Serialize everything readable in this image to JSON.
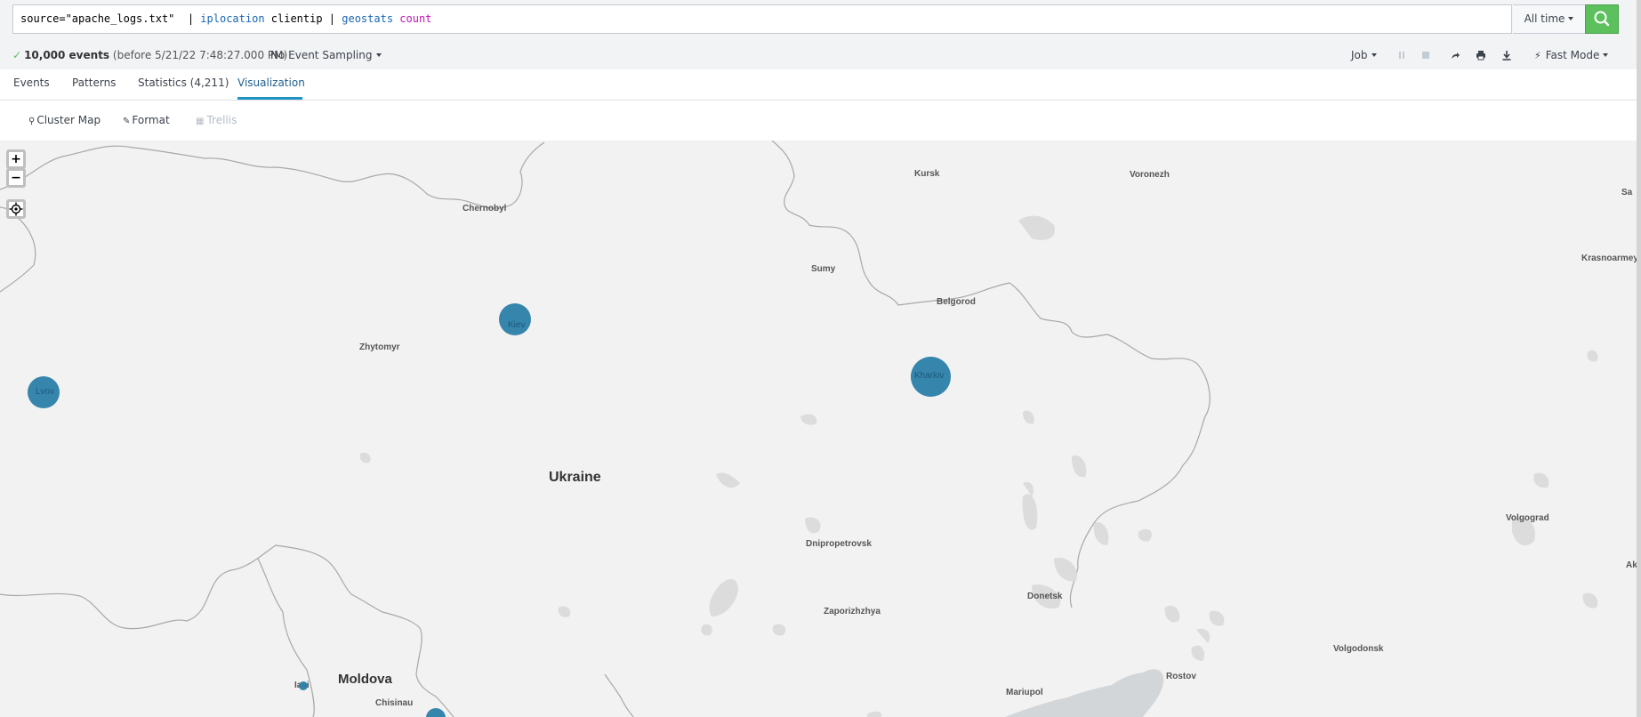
{
  "search": {
    "query_part1": "source=\"apache_logs.txt\"  | ",
    "query_cmd1": "iplocation",
    "query_part2": " clientip | ",
    "query_cmd2": "geostats",
    "query_part3": " ",
    "query_fn": "count",
    "time_range": "All time",
    "search_icon": "magnifier-icon"
  },
  "status": {
    "event_count": "10,000 events",
    "event_suffix": "(before 5/21/22 7:48:27.000 PM)",
    "sampling": "No Event Sampling",
    "job_label": "Job",
    "mode": "Fast Mode"
  },
  "tabs": [
    {
      "label": "Events"
    },
    {
      "label": "Patterns"
    },
    {
      "label": "Statistics (4,211)"
    },
    {
      "label": "Visualization",
      "active": true
    }
  ],
  "viz_toolbar": {
    "cluster_map": "Cluster Map",
    "format": "Format",
    "trellis": "Trellis"
  },
  "map": {
    "cities": [
      {
        "name": "Kursk"
      },
      {
        "name": "Voronezh"
      },
      {
        "name": "Chernobyl"
      },
      {
        "name": "Sumy"
      },
      {
        "name": "Belgorod"
      },
      {
        "name": "Krasnoarmey"
      },
      {
        "name": "Zhytomyr"
      },
      {
        "name": "Dnipropetrovsk"
      },
      {
        "name": "Zaporizhzhya"
      },
      {
        "name": "Donetsk"
      },
      {
        "name": "Volgograd"
      },
      {
        "name": "Volgodonsk"
      },
      {
        "name": "Rostov"
      },
      {
        "name": "Mariupol"
      },
      {
        "name": "Chisinau"
      },
      {
        "name": "Iasi"
      },
      {
        "name": "Sa"
      },
      {
        "name": "Ak"
      }
    ],
    "countries": [
      {
        "name": "Ukraine"
      },
      {
        "name": "Moldova"
      }
    ],
    "marker_labels": [
      "Lvov",
      "Kiev",
      "Kharkiv"
    ],
    "marker_color": "#2b7ea8"
  }
}
